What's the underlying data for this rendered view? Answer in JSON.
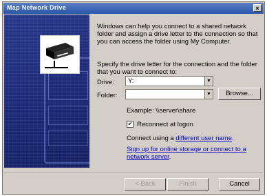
{
  "window": {
    "title": "Map Network Drive",
    "close_label": "×"
  },
  "intro": "Windows can help you connect to a shared network folder and assign a drive letter to the connection so that you can access the folder using My Computer.",
  "instruction": "Specify the drive letter for the connection and the folder that you want to connect to:",
  "drive": {
    "label": "Drive:",
    "value": "Y:"
  },
  "folder": {
    "label": "Folder:",
    "value": ""
  },
  "browse_label": "Browse...",
  "example": "Example: \\\\server\\share",
  "reconnect": {
    "label": "Reconnect at logon",
    "checked": true
  },
  "connect_prefix": "Connect using a ",
  "connect_link": "different user name",
  "connect_suffix": ".",
  "signup_link": "Sign up for online storage or connect to a network server",
  "signup_suffix": ".",
  "buttons": {
    "back": "< Back",
    "finish": "Finish",
    "cancel": "Cancel"
  },
  "icons": {
    "dropdown": "chevron-down-icon",
    "network": "network-drive-icon",
    "checkbox": "check-icon"
  }
}
